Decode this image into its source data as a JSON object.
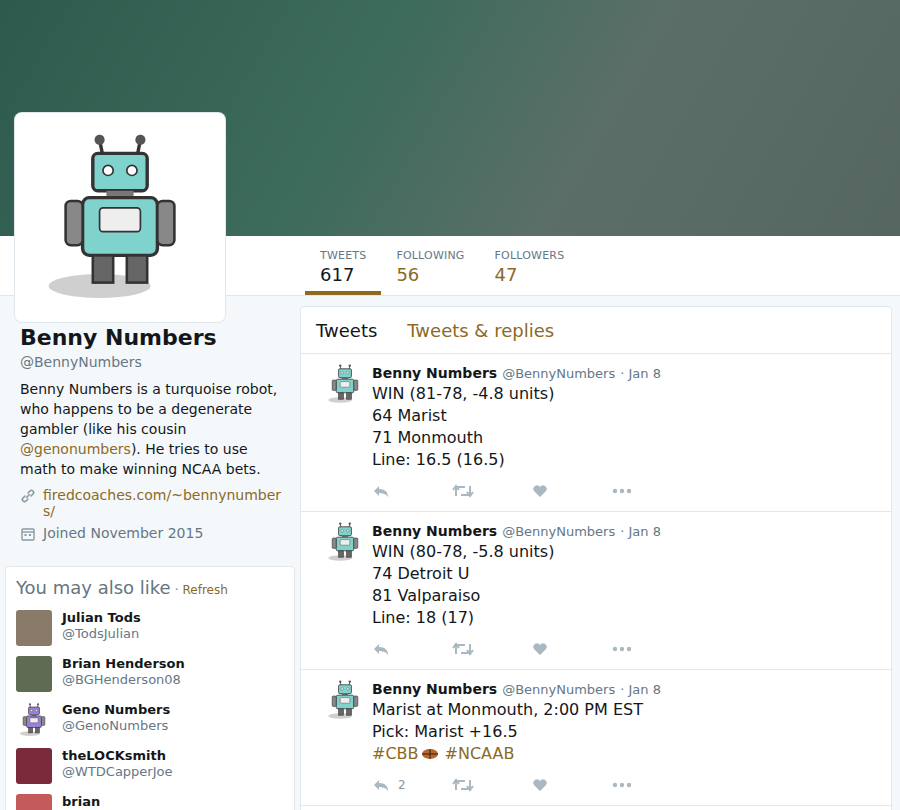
{
  "profile": {
    "name": "Benny Numbers",
    "handle": "@BennyNumbers",
    "bio": [
      {
        "text": "Benny Numbers is a turquoise robot, who happens to be a degenerate gambler (like his cousin ",
        "link": false
      },
      {
        "text": "@genonumbers",
        "link": true
      },
      {
        "text": "). He tries to use math to make winning NCAA bets.",
        "link": false
      }
    ],
    "url": "firedcoaches.com/~bennynumbers/",
    "joined": "Joined November 2015"
  },
  "stats": [
    {
      "label": "TWEETS",
      "value": "617",
      "selected": true
    },
    {
      "label": "FOLLOWING",
      "value": "56",
      "selected": false
    },
    {
      "label": "FOLLOWERS",
      "value": "47",
      "selected": false
    }
  ],
  "timeline_tabs": [
    {
      "label": "Tweets",
      "selected": true
    },
    {
      "label": "Tweets & replies",
      "selected": false
    }
  ],
  "tweets": [
    {
      "name": "Benny Numbers",
      "handle": "@BennyNumbers",
      "date": "· Jan 8",
      "lines": [
        "WIN (81-78, -4.8 units)",
        "64 Marist",
        "71 Monmouth",
        "Line: 16.5 (16.5)"
      ],
      "hashtags": [],
      "replies": ""
    },
    {
      "name": "Benny Numbers",
      "handle": "@BennyNumbers",
      "date": "· Jan 8",
      "lines": [
        "WIN (80-78, -5.8 units)",
        "74 Detroit U",
        "81 Valparaiso",
        "Line: 18 (17)"
      ],
      "hashtags": [],
      "replies": ""
    },
    {
      "name": "Benny Numbers",
      "handle": "@BennyNumbers",
      "date": "· Jan 8",
      "lines": [
        "Marist at Monmouth, 2:00 PM EST",
        "Pick: Marist +16.5"
      ],
      "hashtags": [
        {
          "tag": "#CBB",
          "icon": true
        },
        {
          "tag": "#NCAAB",
          "icon": false
        }
      ],
      "replies": "2"
    }
  ],
  "suggestions": {
    "title": "You may also like",
    "separator": "·",
    "refresh": "Refresh",
    "items": [
      {
        "name": "Julian Tods",
        "handle": "@TodsJulian",
        "kind": "photo",
        "color": "#8a7a6a"
      },
      {
        "name": "Brian Henderson",
        "handle": "@BGHenderson08",
        "kind": "photo",
        "color": "#5f6b52"
      },
      {
        "name": "Geno Numbers",
        "handle": "@GenoNumbers",
        "kind": "robot",
        "color": "#9b7fd9"
      },
      {
        "name": "theLOCKsmith",
        "handle": "@WTDCapperJoe",
        "kind": "photo",
        "color": "#7a2a3a"
      },
      {
        "name": "brian",
        "handle": "",
        "kind": "photo",
        "color": "#c45a5a"
      }
    ]
  }
}
